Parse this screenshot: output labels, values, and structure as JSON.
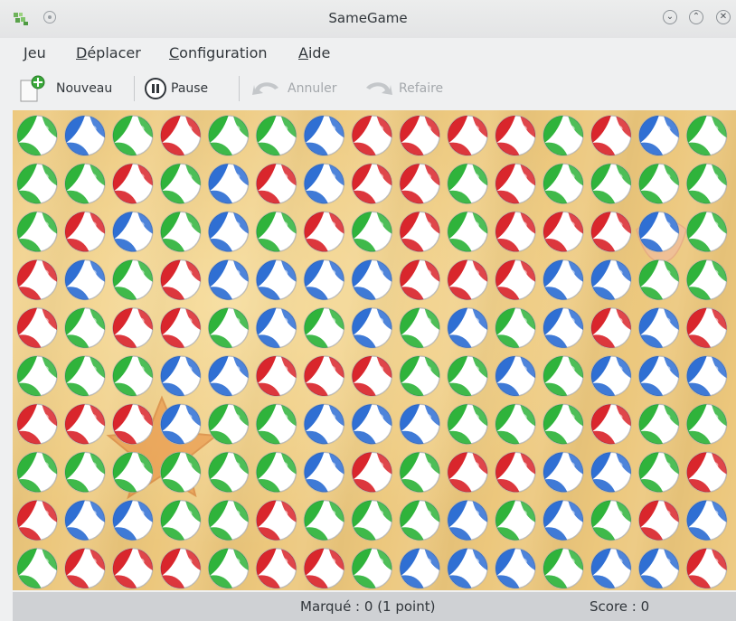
{
  "window": {
    "title": "SameGame"
  },
  "menu": [
    {
      "label": "Jeu",
      "mnemonic": "J"
    },
    {
      "label": "Déplacer",
      "mnemonic": "D"
    },
    {
      "label": "Configuration",
      "mnemonic": "C"
    },
    {
      "label": "Aide",
      "mnemonic": "A"
    }
  ],
  "toolbar": {
    "new_label": "Nouveau",
    "pause_label": "Pause",
    "undo_label": "Annuler",
    "redo_label": "Refaire"
  },
  "status": {
    "marked": "Marqué : 0 (1 point)",
    "score": "Score : 0"
  },
  "colors": {
    "red": "#d9262c",
    "green": "#2fb33b",
    "blue": "#2f6fd3"
  },
  "board": {
    "rows": [
      "GBGRGGBRRRRGRBG",
      "GGRGBRBRRGRGGGG",
      "GRBGBGRGRGRRRBG",
      "RBGRBBBBRRRBBGG",
      "RGRRGBGBGBGBRBR",
      "GGGBBRRRGGBGBBB",
      "RRRBGGBBBGGGRGG",
      "GGGGGGBRGRRBBGR",
      "RBBGGRGGGBGBGRB",
      "GRRRGRRGBBBGBBR"
    ]
  }
}
